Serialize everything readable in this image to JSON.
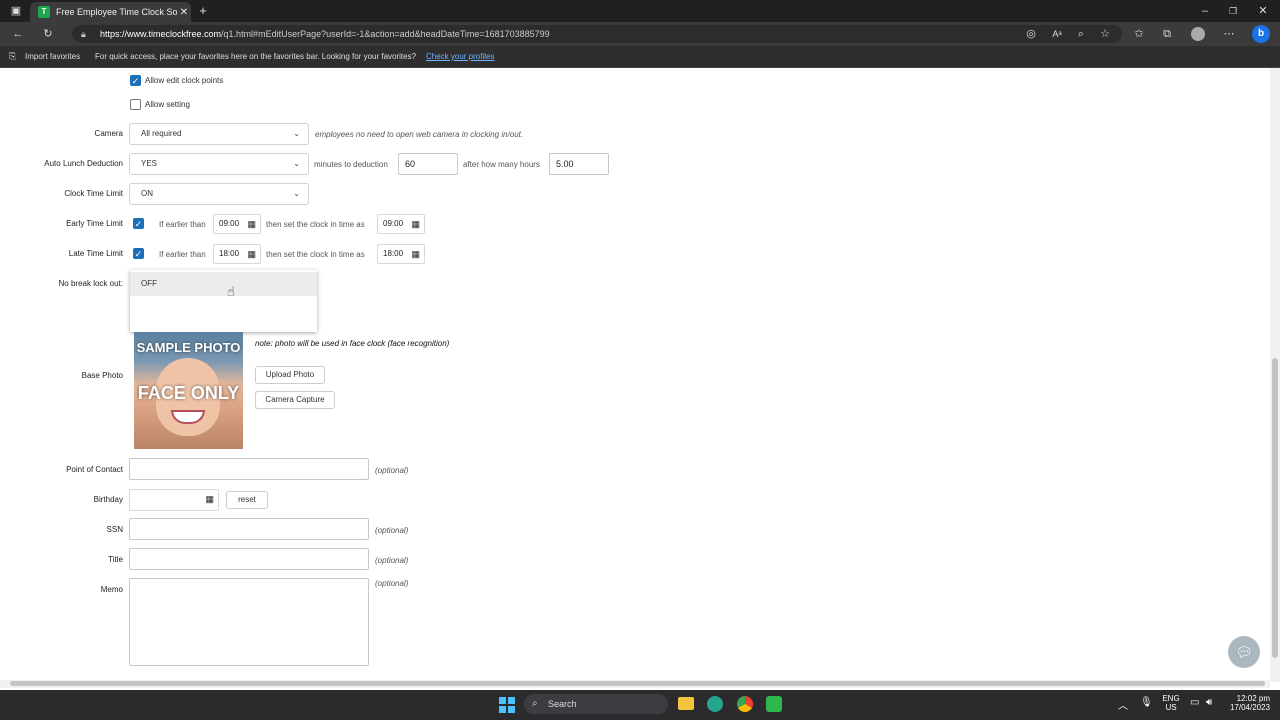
{
  "browser": {
    "tab_title": "Free Employee Time Clock Softw",
    "url_host": "https://www.timeclockfree.com",
    "url_path": "/q1.html#mEditUserPage?userId=-1&action=add&headDateTime=1681703885799",
    "import_favorites": "Import favorites",
    "fav_message": "For quick access, place your favorites here on the favorites bar. Looking for your favorites?",
    "fav_link": "Check your profiles"
  },
  "form": {
    "allow_edit_clock_points": "Allow edit clock points",
    "allow_setting": "Allow setting",
    "camera_label": "Camera",
    "camera_value": "All required",
    "camera_note": "employees no need to open web camera in clocking in/out.",
    "auto_lunch_label": "Auto Lunch Deduction",
    "auto_lunch_value": "YES",
    "minutes_to_deduction": "minutes to deduction",
    "minutes_value": "60",
    "after_hours": "after how many hours",
    "hours_value": "5.00",
    "clock_time_limit_label": "Clock Time Limit",
    "clock_time_limit_value": "ON",
    "early_label": "Early Time Limit",
    "late_label": "Late Time Limit",
    "if_earlier_than": "If earlier than",
    "then_set": "then set the clock in time as",
    "early_time": "09:00",
    "early_set_time": "09:00",
    "late_time": "18:00",
    "late_set_time": "18:00",
    "no_break_label": "No break lock out:",
    "dropdown_option": "OFF",
    "sample_photo": "SAMPLE PHOTO",
    "face_only": "FACE ONLY",
    "photo_note": "note: photo will be used in face clock (face recognition)",
    "base_photo_label": "Base Photo",
    "upload_photo": "Upload Photo",
    "camera_capture": "Camera Capture",
    "point_of_contact_label": "Point of Contact",
    "birthday_label": "Birthday",
    "reset": "reset",
    "ssn_label": "SSN",
    "title_label": "Title",
    "memo_label": "Memo",
    "optional": "(optional)"
  },
  "taskbar": {
    "search": "Search",
    "lang1": "ENG",
    "lang2": "US",
    "time": "12:02 pm",
    "date": "17/04/2023"
  }
}
